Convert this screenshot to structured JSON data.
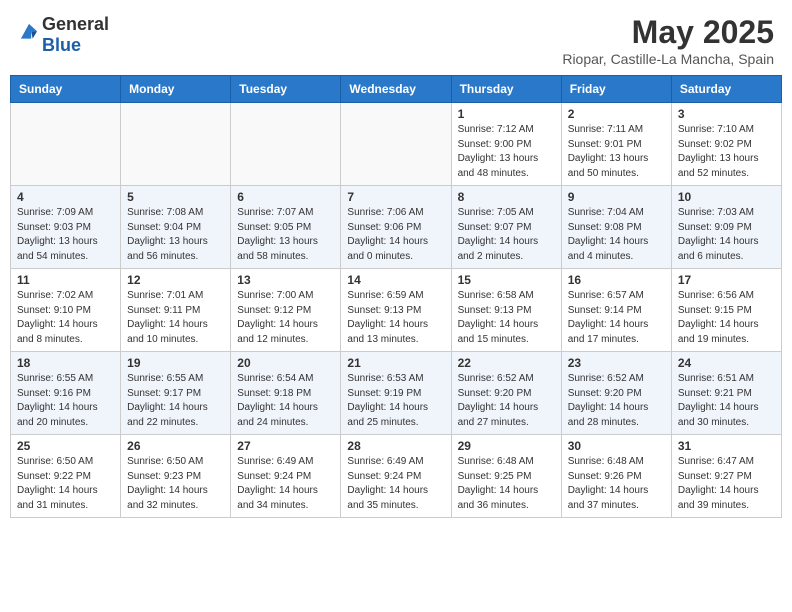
{
  "header": {
    "logo_general": "General",
    "logo_blue": "Blue",
    "title": "May 2025",
    "subtitle": "Riopar, Castille-La Mancha, Spain"
  },
  "columns": [
    "Sunday",
    "Monday",
    "Tuesday",
    "Wednesday",
    "Thursday",
    "Friday",
    "Saturday"
  ],
  "weeks": [
    [
      {
        "day": "",
        "info": ""
      },
      {
        "day": "",
        "info": ""
      },
      {
        "day": "",
        "info": ""
      },
      {
        "day": "",
        "info": ""
      },
      {
        "day": "1",
        "info": "Sunrise: 7:12 AM\nSunset: 9:00 PM\nDaylight: 13 hours\nand 48 minutes."
      },
      {
        "day": "2",
        "info": "Sunrise: 7:11 AM\nSunset: 9:01 PM\nDaylight: 13 hours\nand 50 minutes."
      },
      {
        "day": "3",
        "info": "Sunrise: 7:10 AM\nSunset: 9:02 PM\nDaylight: 13 hours\nand 52 minutes."
      }
    ],
    [
      {
        "day": "4",
        "info": "Sunrise: 7:09 AM\nSunset: 9:03 PM\nDaylight: 13 hours\nand 54 minutes."
      },
      {
        "day": "5",
        "info": "Sunrise: 7:08 AM\nSunset: 9:04 PM\nDaylight: 13 hours\nand 56 minutes."
      },
      {
        "day": "6",
        "info": "Sunrise: 7:07 AM\nSunset: 9:05 PM\nDaylight: 13 hours\nand 58 minutes."
      },
      {
        "day": "7",
        "info": "Sunrise: 7:06 AM\nSunset: 9:06 PM\nDaylight: 14 hours\nand 0 minutes."
      },
      {
        "day": "8",
        "info": "Sunrise: 7:05 AM\nSunset: 9:07 PM\nDaylight: 14 hours\nand 2 minutes."
      },
      {
        "day": "9",
        "info": "Sunrise: 7:04 AM\nSunset: 9:08 PM\nDaylight: 14 hours\nand 4 minutes."
      },
      {
        "day": "10",
        "info": "Sunrise: 7:03 AM\nSunset: 9:09 PM\nDaylight: 14 hours\nand 6 minutes."
      }
    ],
    [
      {
        "day": "11",
        "info": "Sunrise: 7:02 AM\nSunset: 9:10 PM\nDaylight: 14 hours\nand 8 minutes."
      },
      {
        "day": "12",
        "info": "Sunrise: 7:01 AM\nSunset: 9:11 PM\nDaylight: 14 hours\nand 10 minutes."
      },
      {
        "day": "13",
        "info": "Sunrise: 7:00 AM\nSunset: 9:12 PM\nDaylight: 14 hours\nand 12 minutes."
      },
      {
        "day": "14",
        "info": "Sunrise: 6:59 AM\nSunset: 9:13 PM\nDaylight: 14 hours\nand 13 minutes."
      },
      {
        "day": "15",
        "info": "Sunrise: 6:58 AM\nSunset: 9:13 PM\nDaylight: 14 hours\nand 15 minutes."
      },
      {
        "day": "16",
        "info": "Sunrise: 6:57 AM\nSunset: 9:14 PM\nDaylight: 14 hours\nand 17 minutes."
      },
      {
        "day": "17",
        "info": "Sunrise: 6:56 AM\nSunset: 9:15 PM\nDaylight: 14 hours\nand 19 minutes."
      }
    ],
    [
      {
        "day": "18",
        "info": "Sunrise: 6:55 AM\nSunset: 9:16 PM\nDaylight: 14 hours\nand 20 minutes."
      },
      {
        "day": "19",
        "info": "Sunrise: 6:55 AM\nSunset: 9:17 PM\nDaylight: 14 hours\nand 22 minutes."
      },
      {
        "day": "20",
        "info": "Sunrise: 6:54 AM\nSunset: 9:18 PM\nDaylight: 14 hours\nand 24 minutes."
      },
      {
        "day": "21",
        "info": "Sunrise: 6:53 AM\nSunset: 9:19 PM\nDaylight: 14 hours\nand 25 minutes."
      },
      {
        "day": "22",
        "info": "Sunrise: 6:52 AM\nSunset: 9:20 PM\nDaylight: 14 hours\nand 27 minutes."
      },
      {
        "day": "23",
        "info": "Sunrise: 6:52 AM\nSunset: 9:20 PM\nDaylight: 14 hours\nand 28 minutes."
      },
      {
        "day": "24",
        "info": "Sunrise: 6:51 AM\nSunset: 9:21 PM\nDaylight: 14 hours\nand 30 minutes."
      }
    ],
    [
      {
        "day": "25",
        "info": "Sunrise: 6:50 AM\nSunset: 9:22 PM\nDaylight: 14 hours\nand 31 minutes."
      },
      {
        "day": "26",
        "info": "Sunrise: 6:50 AM\nSunset: 9:23 PM\nDaylight: 14 hours\nand 32 minutes."
      },
      {
        "day": "27",
        "info": "Sunrise: 6:49 AM\nSunset: 9:24 PM\nDaylight: 14 hours\nand 34 minutes."
      },
      {
        "day": "28",
        "info": "Sunrise: 6:49 AM\nSunset: 9:24 PM\nDaylight: 14 hours\nand 35 minutes."
      },
      {
        "day": "29",
        "info": "Sunrise: 6:48 AM\nSunset: 9:25 PM\nDaylight: 14 hours\nand 36 minutes."
      },
      {
        "day": "30",
        "info": "Sunrise: 6:48 AM\nSunset: 9:26 PM\nDaylight: 14 hours\nand 37 minutes."
      },
      {
        "day": "31",
        "info": "Sunrise: 6:47 AM\nSunset: 9:27 PM\nDaylight: 14 hours\nand 39 minutes."
      }
    ]
  ]
}
